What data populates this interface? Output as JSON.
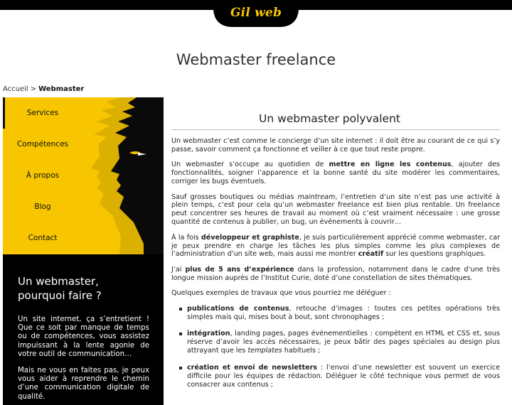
{
  "header": {
    "logo_text": "Gil web",
    "page_title": "Webmaster freelance"
  },
  "breadcrumb": {
    "home": "Accueil",
    "separator": ">",
    "current": "Webmaster"
  },
  "sidebar": {
    "nav": [
      {
        "label": "Services"
      },
      {
        "label": "Compétences"
      },
      {
        "label": "À propos"
      },
      {
        "label": "Blog"
      },
      {
        "label": "Contact"
      }
    ],
    "promo": {
      "title": "Un webmaster, pourquoi faire ?",
      "p1": "Un site internet, ça s’entretient ! Que ce soit par manque de temps ou de compétences, vous assistez impuissant à la lente agonie de votre outil de communication…",
      "p2": "Mais ne vous en faites pas, je peux vous aider à reprendre le chemin d’une communication digitale de qualité."
    }
  },
  "main": {
    "heading": "Un webmaster polyvalent",
    "p1": "Un webmaster c’est comme le concierge d’un site internet : il doit être au courant de ce qui s’y passe, savoir comment ça fonctionne et veiller à ce que tout reste propre.",
    "p2_a": "Un webmaster s’occupe au quotidien de ",
    "p2_b": "mettre en ligne les contenus",
    "p2_c": ", ajouter des fonctionnalités, soigner l’apparence et la bonne santé du site modérer les commentaires, corriger les bugs éventuels.",
    "p3_a": "Sauf grosses boutiques ou médias ",
    "p3_b": "maintream",
    "p3_c": ", l’entretien d’un site n’est pas une activité à plein temps, c’est pour cela qu’un webmaster freelance est bien plus rentable. Un freelance peut concentrer ses heures de travail au moment où c’est vraiment nécessaire : une grosse quantité de contenus à publier, un bug, un événements à couvrir…",
    "p4_a": "À la fois ",
    "p4_b": "développeur et graphiste",
    "p4_c": ", je suis particulièrement apprécié comme webmaster, car je peux prendre en charge les tâches les plus simples comme les plus complexes de l’administration d’un site web, mais aussi me montrer ",
    "p4_d": "créatif",
    "p4_e": " sur les questions graphiques.",
    "p5_a": "J’ai ",
    "p5_b": "plus de 5 ans d’expérience",
    "p5_c": " dans la profession, notamment dans le cadre d’une très longue mission auprès de l’Institut Curie, doté d’une constellation de sites thématiques.",
    "p6": "Quelques exemples de travaux que vous pourriez me déléguer :",
    "li1_a": "publications de contenus",
    "li1_b": ", retouche d’images : toutes ces petites opérations très simples mais qui, mises bout à bout, sont chronophages ;",
    "li2_a": "intégration",
    "li2_b": ", landing pages, pages événementielles : compétent en HTML et CSS et, sous réserve d’avoir les accès nécessaires, je peux bâtir des pages spéciales au design plus attrayant que les ",
    "li2_c": "templates",
    "li2_d": " habituels ;",
    "li3_a": "création et envoi de newsletters",
    "li3_b": " : l’envoi d’une newsletter est souvent un exercice difficile pour les équipes de rédaction. Déléguer le côté technique vous permet de vous consacrer aux contenus ;"
  },
  "colors": {
    "accent": "#f7c600",
    "dark": "#000000"
  }
}
